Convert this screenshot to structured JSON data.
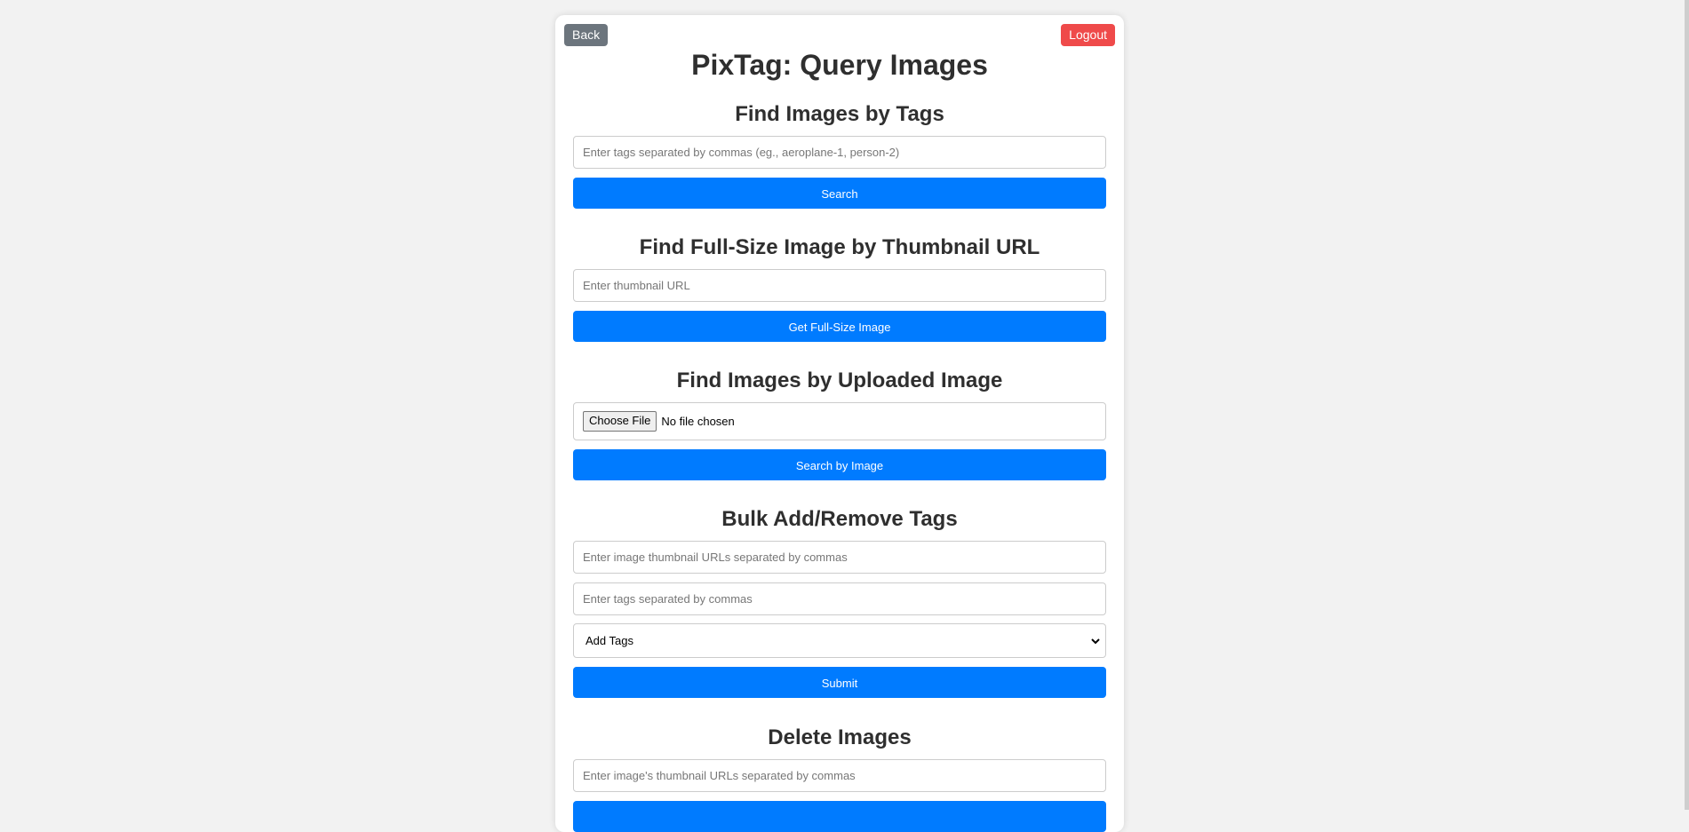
{
  "nav": {
    "back_label": "Back",
    "logout_label": "Logout"
  },
  "page_title": "PixTag: Query Images",
  "colors": {
    "primary": "#007bff",
    "back": "#6c757d",
    "logout": "#ef4a4a",
    "background": "#f2f2f2"
  },
  "sections": {
    "tags": {
      "heading": "Find Images by Tags",
      "placeholder": "Enter tags separated by commas (eg., aeroplane-1, person-2)",
      "button": "Search"
    },
    "thumbnail": {
      "heading": "Find Full-Size Image by Thumbnail URL",
      "placeholder": "Enter thumbnail URL",
      "button": "Get Full-Size Image"
    },
    "upload": {
      "heading": "Find Images by Uploaded Image",
      "file_button": "Choose File",
      "file_status": "No file chosen",
      "button": "Search by Image"
    },
    "bulk": {
      "heading": "Bulk Add/Remove Tags",
      "urls_placeholder": "Enter image thumbnail URLs separated by commas",
      "tags_placeholder": "Enter tags separated by commas",
      "action_selected": "Add Tags",
      "action_icon": "chevron-down-icon",
      "button": "Submit"
    },
    "delete": {
      "heading": "Delete Images",
      "placeholder": "Enter image's thumbnail URLs separated by commas"
    }
  }
}
